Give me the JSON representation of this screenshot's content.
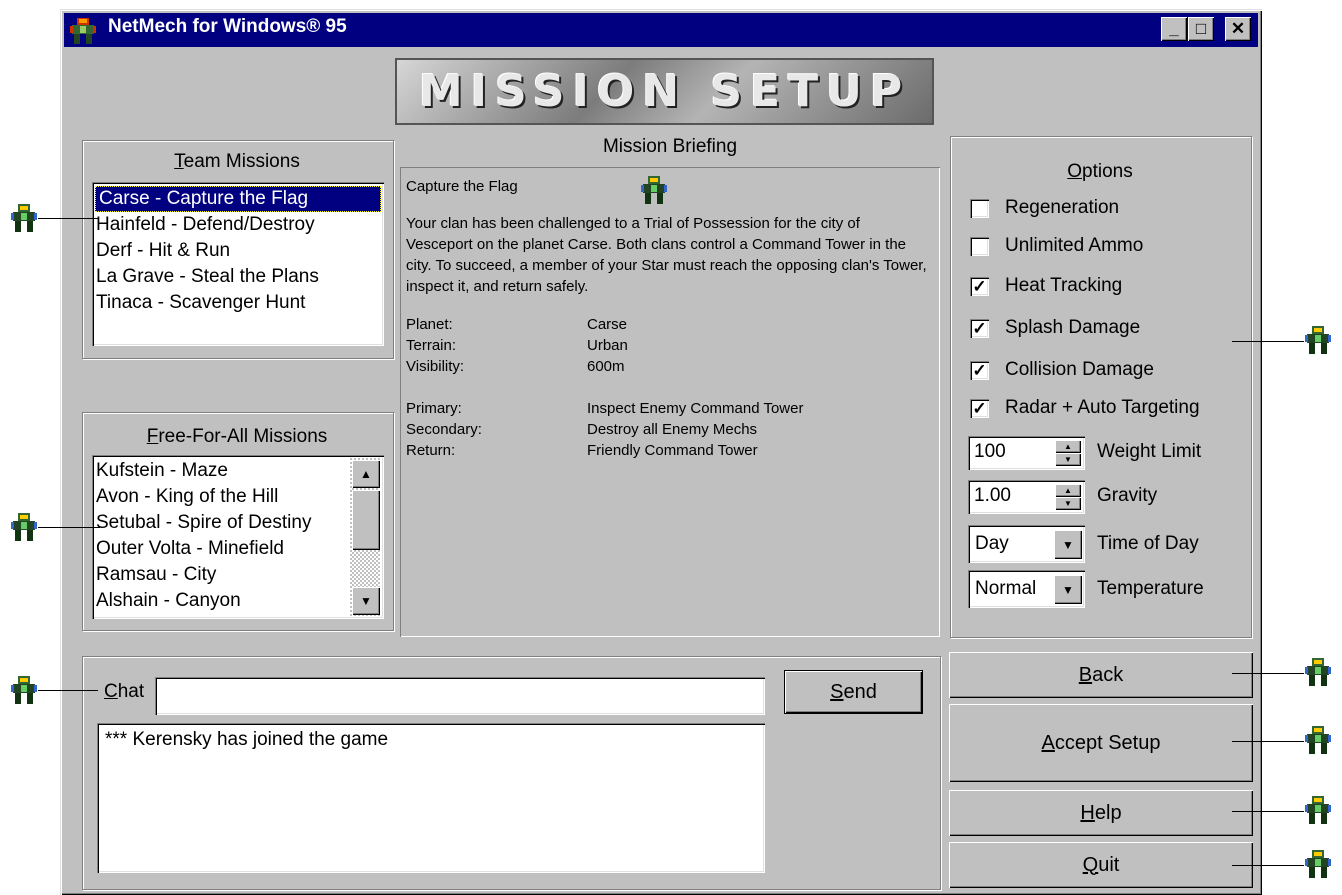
{
  "window": {
    "title": "NetMech for Windows® 95",
    "minimize": "_",
    "maximize": "□",
    "close": "✕"
  },
  "banner": {
    "text": "MISSION SETUP"
  },
  "team_missions": {
    "label": "Team Missions",
    "items": [
      "Carse - Capture the Flag",
      "Hainfeld - Defend/Destroy",
      "Derf - Hit & Run",
      "La Grave - Steal the Plans",
      "Tinaca - Scavenger Hunt"
    ],
    "selected_index": 0
  },
  "ffa_missions": {
    "label": "Free-For-All Missions",
    "items": [
      "Kufstein - Maze",
      "Avon - King of the Hill",
      "Setubal - Spire of Destiny",
      "Outer Volta - Minefield",
      "Ramsau - City",
      "Alshain - Canyon"
    ]
  },
  "briefing": {
    "label": "Mission Briefing",
    "mission_title": "Capture the Flag",
    "description": "Your clan has been challenged to a Trial of Possession for the city of Vesceport on the planet Carse.  Both clans control a Command Tower in the city.  To succeed, a member of your Star must reach the opposing clan's Tower, inspect it, and return safely.",
    "details1": [
      {
        "key": "Planet:",
        "value": "Carse"
      },
      {
        "key": "Terrain:",
        "value": "Urban"
      },
      {
        "key": "Visibility:",
        "value": "600m"
      }
    ],
    "details2": [
      {
        "key": "Primary:",
        "value": "Inspect Enemy Command Tower"
      },
      {
        "key": "Secondary:",
        "value": "Destroy all Enemy Mechs"
      },
      {
        "key": "Return:",
        "value": "Friendly Command Tower"
      }
    ]
  },
  "options": {
    "label": "Options",
    "checkboxes": [
      {
        "label": "Regeneration",
        "checked": false
      },
      {
        "label": "Unlimited Ammo",
        "checked": false
      },
      {
        "label": "Heat Tracking",
        "checked": true
      },
      {
        "label": "Splash Damage",
        "checked": true
      },
      {
        "label": "Collision Damage",
        "checked": true
      },
      {
        "label": "Radar + Auto Targeting",
        "checked": true
      }
    ],
    "weight_limit": {
      "value": "100",
      "label": "Weight Limit"
    },
    "gravity": {
      "value": "1.00",
      "label": "Gravity"
    },
    "time_of_day": {
      "value": "Day",
      "label": "Time of Day"
    },
    "temperature": {
      "value": "Normal",
      "label": "Temperature"
    }
  },
  "chat": {
    "label": "Chat",
    "input_value": "",
    "send_label": "Send",
    "log": "*** Kerensky has joined the game"
  },
  "buttons": {
    "back": "Back",
    "accept": "Accept Setup",
    "help": "Help",
    "quit": "Quit"
  },
  "check_glyph": "✓",
  "colors": {
    "titlebar": "#000080",
    "face": "#c0c0c0",
    "selection": "#000080"
  }
}
